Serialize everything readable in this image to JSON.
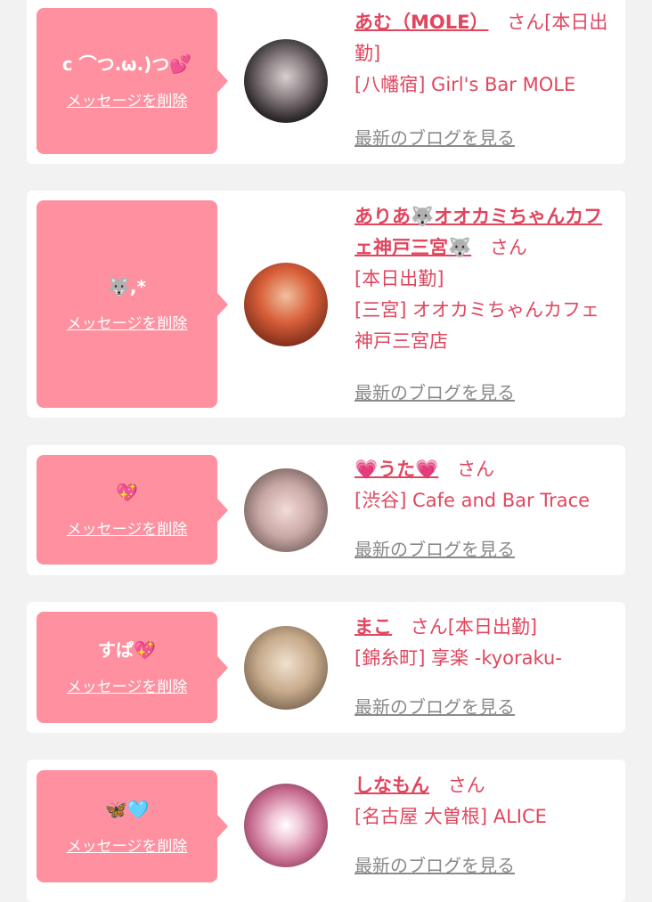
{
  "colors": {
    "background": "#f2f2f2",
    "card": "#ffffff",
    "bubble": "#fe909f",
    "accent_text": "#e0465e",
    "link_gray": "#8a8a8a"
  },
  "entries": [
    {
      "message": "c ⌒つ.ω.)つ💕",
      "delete_label": "メッセージを削除",
      "name": "あむ（MOLE）",
      "honorific": "さん",
      "status": "[本日出勤]",
      "shop": "[八幡宿] Girl's Bar MOLE",
      "blog_link": "最新のブログを見る"
    },
    {
      "message": "🐺,*",
      "delete_label": "メッセージを削除",
      "name": "ありあ🐺オオカミちゃんカフェ神戸三宮🐺",
      "honorific": "さん",
      "status": "[本日出勤]",
      "shop": "[三宮] オオカミちゃんカフェ神戸三宮店",
      "blog_link": "最新のブログを見る"
    },
    {
      "message": "💖",
      "delete_label": "メッセージを削除",
      "name": "💗うた💗",
      "honorific": "さん",
      "shop": "[渋谷] Cafe and Bar Trace",
      "blog_link": "最新のブログを見る"
    },
    {
      "message": "すぱ💖",
      "delete_label": "メッセージを削除",
      "name": "まこ",
      "honorific": "さん",
      "status": "[本日出勤]",
      "shop": "[錦糸町] 享楽 -kyoraku-",
      "blog_link": "最新のブログを見る"
    },
    {
      "message": "🦋🩵",
      "delete_label": "メッセージを削除",
      "name": "しなもん",
      "honorific": "さん",
      "shop": "[名古屋 大曽根] ALICE",
      "blog_link": "最新のブログを見る"
    }
  ]
}
